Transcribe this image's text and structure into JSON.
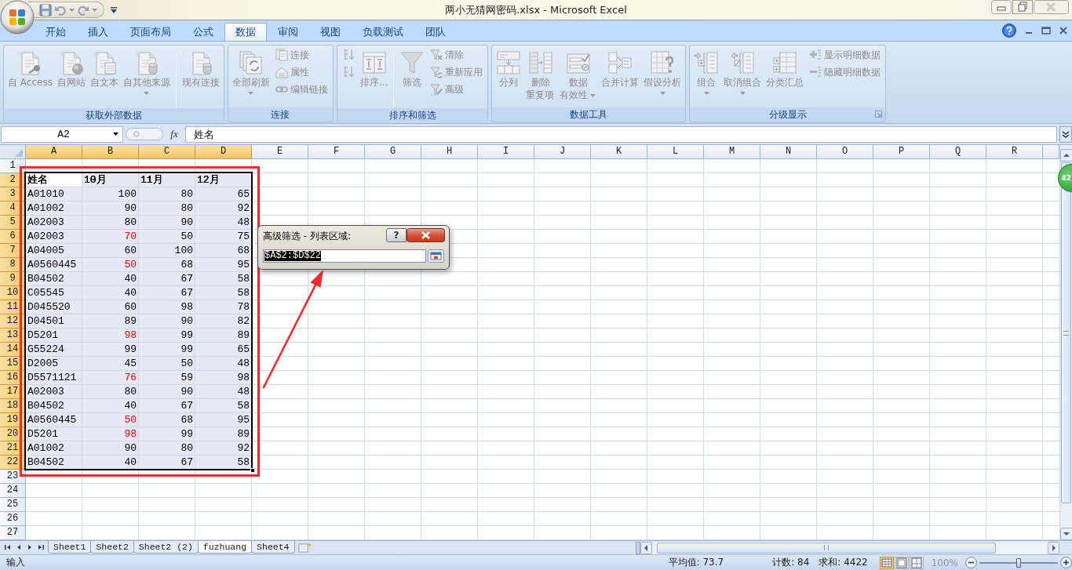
{
  "window": {
    "title": "两小无猜网密码.xlsx - Microsoft Excel"
  },
  "tabs": [
    {
      "label": "开始",
      "selected": false
    },
    {
      "label": "插入",
      "selected": false
    },
    {
      "label": "页面布局",
      "selected": false
    },
    {
      "label": "公式",
      "selected": false
    },
    {
      "label": "数据",
      "selected": true
    },
    {
      "label": "审阅",
      "selected": false
    },
    {
      "label": "视图",
      "selected": false
    },
    {
      "label": "负载测试",
      "selected": false
    },
    {
      "label": "团队",
      "selected": false
    }
  ],
  "ribbon": {
    "groups": [
      {
        "title": "获取外部数据",
        "launcher": false,
        "items": [
          {
            "kind": "large",
            "label": "自 Access",
            "disabled": true,
            "dropdown": false
          },
          {
            "kind": "large",
            "label": "自网站",
            "disabled": true,
            "dropdown": false
          },
          {
            "kind": "large",
            "label": "自文本",
            "disabled": true,
            "dropdown": false
          },
          {
            "kind": "large",
            "label": "自其他来源",
            "disabled": true,
            "dropdown": true
          },
          {
            "kind": "separator"
          },
          {
            "kind": "large",
            "label": "现有连接",
            "disabled": true,
            "dropdown": false
          }
        ]
      },
      {
        "title": "连接",
        "launcher": false,
        "items": [
          {
            "kind": "large",
            "label": "全部刷新",
            "disabled": true,
            "dropdown": true
          },
          {
            "kind": "stack",
            "buttons": [
              {
                "label": "连接",
                "disabled": true
              },
              {
                "label": "属性",
                "disabled": true
              },
              {
                "label": "编辑链接",
                "disabled": true
              }
            ]
          }
        ]
      },
      {
        "title": "排序和筛选",
        "launcher": false,
        "items": [
          {
            "kind": "stack",
            "buttons": [
              {
                "disabled": true
              },
              {
                "disabled": true
              }
            ]
          },
          {
            "kind": "large",
            "label": "排序...",
            "disabled": true,
            "dropdown": false
          },
          {
            "kind": "separator"
          },
          {
            "kind": "large",
            "label": "筛选",
            "disabled": true,
            "dropdown": false
          },
          {
            "kind": "stack",
            "buttons": [
              {
                "label": "清除",
                "disabled": true
              },
              {
                "label": "重新应用",
                "disabled": true
              },
              {
                "label": "高级",
                "disabled": true
              }
            ]
          }
        ]
      },
      {
        "title": "数据工具",
        "launcher": false,
        "items": [
          {
            "kind": "large",
            "label": "分列",
            "disabled": true,
            "dropdown": false
          },
          {
            "kind": "large_two_line",
            "label": "删除重复项",
            "disabled": true,
            "dropdown": false
          },
          {
            "kind": "large_two_line",
            "label": "数据有效性",
            "disabled": true,
            "dropdown": true
          },
          {
            "kind": "large",
            "label": "合并计算",
            "disabled": true,
            "dropdown": false
          },
          {
            "kind": "large",
            "label": "假设分析",
            "disabled": true,
            "dropdown": true
          }
        ]
      },
      {
        "title": "分级显示",
        "launcher": true,
        "items": [
          {
            "kind": "large",
            "label": "组合",
            "disabled": true,
            "dropdown": true
          },
          {
            "kind": "large",
            "label": "取消组合",
            "disabled": true,
            "dropdown": true
          },
          {
            "kind": "large",
            "label": "分类汇总",
            "disabled": true,
            "dropdown": false
          },
          {
            "kind": "stack",
            "buttons": [
              {
                "label": "显示明细数据",
                "disabled": true
              },
              {
                "label": "隐藏明细数据",
                "disabled": true
              }
            ]
          }
        ]
      }
    ]
  },
  "formula_bar": {
    "name_box": "A2",
    "function_button": "fx",
    "formula": "姓名"
  },
  "sheet": {
    "columns": [
      {
        "label": "A",
        "selected": true
      },
      {
        "label": "B",
        "selected": true
      },
      {
        "label": "C",
        "selected": true
      },
      {
        "label": "D",
        "selected": true
      },
      {
        "label": "E",
        "selected": false
      },
      {
        "label": "F",
        "selected": false
      },
      {
        "label": "G",
        "selected": false
      },
      {
        "label": "H",
        "selected": false
      },
      {
        "label": "I",
        "selected": false
      },
      {
        "label": "J",
        "selected": false
      },
      {
        "label": "K",
        "selected": false
      },
      {
        "label": "L",
        "selected": false
      },
      {
        "label": "M",
        "selected": false
      },
      {
        "label": "N",
        "selected": false
      },
      {
        "label": "O",
        "selected": false
      },
      {
        "label": "P",
        "selected": false
      },
      {
        "label": "Q",
        "selected": false
      },
      {
        "label": "R",
        "selected": false
      }
    ],
    "rows": [
      {
        "header": "1",
        "selected": false,
        "kind": "empty"
      },
      {
        "header": "2",
        "selected": true,
        "kind": "header",
        "cells": [
          {
            "text": "姓名",
            "color": "#000000",
            "active": true
          },
          {
            "text": "10月",
            "color": "#000000",
            "active": false
          },
          {
            "text": "11月",
            "color": "#000000",
            "active": false
          },
          {
            "text": "12月",
            "color": "#000000",
            "active": false
          }
        ]
      },
      {
        "header": "3",
        "selected": true,
        "kind": "data",
        "cells": [
          {
            "text": "A01010",
            "color": "#000000",
            "active": false
          },
          {
            "text": "100",
            "color": "#000000",
            "active": false
          },
          {
            "text": "80",
            "color": "#000000",
            "active": false
          },
          {
            "text": "65",
            "color": "#000000",
            "active": false
          }
        ]
      },
      {
        "header": "4",
        "selected": true,
        "kind": "data",
        "cells": [
          {
            "text": "A01002",
            "color": "#000000",
            "active": false
          },
          {
            "text": "90",
            "color": "#000000",
            "active": false
          },
          {
            "text": "80",
            "color": "#000000",
            "active": false
          },
          {
            "text": "92",
            "color": "#000000",
            "active": false
          }
        ]
      },
      {
        "header": "5",
        "selected": true,
        "kind": "data",
        "cells": [
          {
            "text": "A02003",
            "color": "#000000",
            "active": false
          },
          {
            "text": "80",
            "color": "#000000",
            "active": false
          },
          {
            "text": "90",
            "color": "#000000",
            "active": false
          },
          {
            "text": "48",
            "color": "#000000",
            "active": false
          }
        ]
      },
      {
        "header": "6",
        "selected": true,
        "kind": "data",
        "cells": [
          {
            "text": "A02003",
            "color": "#000000",
            "active": false
          },
          {
            "text": "70",
            "color": "#ff0000",
            "active": false
          },
          {
            "text": "50",
            "color": "#000000",
            "active": false
          },
          {
            "text": "75",
            "color": "#000000",
            "active": false
          }
        ]
      },
      {
        "header": "7",
        "selected": true,
        "kind": "data",
        "cells": [
          {
            "text": "A04005",
            "color": "#000000",
            "active": false
          },
          {
            "text": "60",
            "color": "#000000",
            "active": false
          },
          {
            "text": "100",
            "color": "#000000",
            "active": false
          },
          {
            "text": "68",
            "color": "#000000",
            "active": false
          }
        ]
      },
      {
        "header": "8",
        "selected": true,
        "kind": "data",
        "cells": [
          {
            "text": "A0560445",
            "color": "#000000",
            "active": false
          },
          {
            "text": "50",
            "color": "#ff0000",
            "active": false
          },
          {
            "text": "68",
            "color": "#000000",
            "active": false
          },
          {
            "text": "95",
            "color": "#000000",
            "active": false
          }
        ]
      },
      {
        "header": "9",
        "selected": true,
        "kind": "data",
        "cells": [
          {
            "text": "B04502",
            "color": "#000000",
            "active": false
          },
          {
            "text": "40",
            "color": "#000000",
            "active": false
          },
          {
            "text": "67",
            "color": "#000000",
            "active": false
          },
          {
            "text": "58",
            "color": "#000000",
            "active": false
          }
        ]
      },
      {
        "header": "10",
        "selected": true,
        "kind": "data",
        "cells": [
          {
            "text": "C05545",
            "color": "#000000",
            "active": false
          },
          {
            "text": "40",
            "color": "#000000",
            "active": false
          },
          {
            "text": "67",
            "color": "#000000",
            "active": false
          },
          {
            "text": "58",
            "color": "#000000",
            "active": false
          }
        ]
      },
      {
        "header": "11",
        "selected": true,
        "kind": "data",
        "cells": [
          {
            "text": "D045520",
            "color": "#000000",
            "active": false
          },
          {
            "text": "60",
            "color": "#000000",
            "active": false
          },
          {
            "text": "98",
            "color": "#000000",
            "active": false
          },
          {
            "text": "78",
            "color": "#000000",
            "active": false
          }
        ]
      },
      {
        "header": "12",
        "selected": true,
        "kind": "data",
        "cells": [
          {
            "text": "D04501",
            "color": "#000000",
            "active": false
          },
          {
            "text": "89",
            "color": "#000000",
            "active": false
          },
          {
            "text": "90",
            "color": "#000000",
            "active": false
          },
          {
            "text": "82",
            "color": "#000000",
            "active": false
          }
        ]
      },
      {
        "header": "13",
        "selected": true,
        "kind": "data",
        "cells": [
          {
            "text": "D5201",
            "color": "#000000",
            "active": false
          },
          {
            "text": "98",
            "color": "#ff0000",
            "active": false
          },
          {
            "text": "99",
            "color": "#000000",
            "active": false
          },
          {
            "text": "89",
            "color": "#000000",
            "active": false
          }
        ]
      },
      {
        "header": "14",
        "selected": true,
        "kind": "data",
        "cells": [
          {
            "text": "G55224",
            "color": "#000000",
            "active": false
          },
          {
            "text": "99",
            "color": "#000000",
            "active": false
          },
          {
            "text": "99",
            "color": "#000000",
            "active": false
          },
          {
            "text": "65",
            "color": "#000000",
            "active": false
          }
        ]
      },
      {
        "header": "15",
        "selected": true,
        "kind": "data",
        "cells": [
          {
            "text": "D2005",
            "color": "#000000",
            "active": false
          },
          {
            "text": "45",
            "color": "#000000",
            "active": false
          },
          {
            "text": "50",
            "color": "#000000",
            "active": false
          },
          {
            "text": "48",
            "color": "#000000",
            "active": false
          }
        ]
      },
      {
        "header": "16",
        "selected": true,
        "kind": "data",
        "cells": [
          {
            "text": "D5571121",
            "color": "#000000",
            "active": false
          },
          {
            "text": "76",
            "color": "#ff0000",
            "active": false
          },
          {
            "text": "59",
            "color": "#000000",
            "active": false
          },
          {
            "text": "98",
            "color": "#000000",
            "active": false
          }
        ]
      },
      {
        "header": "17",
        "selected": true,
        "kind": "data",
        "cells": [
          {
            "text": "A02003",
            "color": "#000000",
            "active": false
          },
          {
            "text": "80",
            "color": "#000000",
            "active": false
          },
          {
            "text": "90",
            "color": "#000000",
            "active": false
          },
          {
            "text": "48",
            "color": "#000000",
            "active": false
          }
        ]
      },
      {
        "header": "18",
        "selected": true,
        "kind": "data",
        "cells": [
          {
            "text": "B04502",
            "color": "#000000",
            "active": false
          },
          {
            "text": "40",
            "color": "#000000",
            "active": false
          },
          {
            "text": "67",
            "color": "#000000",
            "active": false
          },
          {
            "text": "58",
            "color": "#000000",
            "active": false
          }
        ]
      },
      {
        "header": "19",
        "selected": true,
        "kind": "data",
        "cells": [
          {
            "text": "A0560445",
            "color": "#000000",
            "active": false
          },
          {
            "text": "50",
            "color": "#ff0000",
            "active": false
          },
          {
            "text": "68",
            "color": "#000000",
            "active": false
          },
          {
            "text": "95",
            "color": "#000000",
            "active": false
          }
        ]
      },
      {
        "header": "20",
        "selected": true,
        "kind": "data",
        "cells": [
          {
            "text": "D5201",
            "color": "#000000",
            "active": false
          },
          {
            "text": "98",
            "color": "#ff0000",
            "active": false
          },
          {
            "text": "99",
            "color": "#000000",
            "active": false
          },
          {
            "text": "89",
            "color": "#000000",
            "active": false
          }
        ]
      },
      {
        "header": "21",
        "selected": true,
        "kind": "data",
        "cells": [
          {
            "text": "A01002",
            "color": "#000000",
            "active": false
          },
          {
            "text": "90",
            "color": "#000000",
            "active": false
          },
          {
            "text": "80",
            "color": "#000000",
            "active": false
          },
          {
            "text": "92",
            "color": "#000000",
            "active": false
          }
        ]
      },
      {
        "header": "22",
        "selected": true,
        "kind": "data",
        "cells": [
          {
            "text": "B04502",
            "color": "#000000",
            "active": false
          },
          {
            "text": "40",
            "color": "#000000",
            "active": false
          },
          {
            "text": "67",
            "color": "#000000",
            "active": false
          },
          {
            "text": "58",
            "color": "#000000",
            "active": false
          }
        ]
      },
      {
        "header": "23",
        "selected": false,
        "kind": "empty"
      },
      {
        "header": "24",
        "selected": false,
        "kind": "empty"
      },
      {
        "header": "25",
        "selected": false,
        "kind": "empty"
      },
      {
        "header": "26",
        "selected": false,
        "kind": "empty"
      },
      {
        "header": "27",
        "selected": false,
        "kind": "empty"
      }
    ]
  },
  "dialog": {
    "title": "高级筛选 - 列表区域:",
    "help_label": "?",
    "value": "$A$2:$D$22"
  },
  "floating_badge": {
    "text": "42"
  },
  "sheet_tabs": [
    {
      "label": "Sheet1",
      "selected": false
    },
    {
      "label": "Sheet2",
      "selected": false
    },
    {
      "label": "Sheet2 (2)",
      "selected": false
    },
    {
      "label": "fuzhuang",
      "selected": true
    },
    {
      "label": "Sheet4",
      "selected": false
    }
  ],
  "status_bar": {
    "mode": "输入",
    "average": "平均值: 73.7",
    "count": "计数: 84",
    "sum": "求和: 4422",
    "views": [
      {
        "kind": "normal",
        "selected": true
      },
      {
        "kind": "page_layout",
        "selected": false
      },
      {
        "kind": "page_break",
        "selected": false
      }
    ],
    "zoom": "100%",
    "zoom_slider": {
      "level": 0.5
    }
  }
}
